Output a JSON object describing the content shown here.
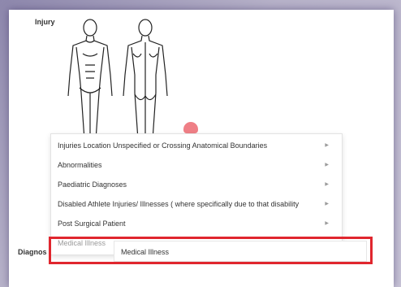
{
  "form": {
    "injury_label": "Injury",
    "diagnosis_label": "Diagnos"
  },
  "menu": {
    "items": [
      {
        "label": "Injuries Location Unspecified or Crossing Anatomical Boundaries",
        "has_submenu": true
      },
      {
        "label": "Abnormalities",
        "has_submenu": true
      },
      {
        "label": "Paediatric Diagnoses",
        "has_submenu": true
      },
      {
        "label": "Disabled Athlete Injuries/ Illnesses ( where specifically due to that disability",
        "has_submenu": true
      },
      {
        "label": "Post Surgical Patient",
        "has_submenu": true
      },
      {
        "label": "Medical Illness",
        "has_submenu": true
      }
    ],
    "arrow_glyph": "▶"
  },
  "submenu": {
    "label": "Medical Illness"
  },
  "colors": {
    "highlight": "#e0262e",
    "marker": "#ef7f86"
  },
  "icons": [
    "body-front-icon",
    "body-back-icon",
    "submenu-arrow-icon"
  ]
}
